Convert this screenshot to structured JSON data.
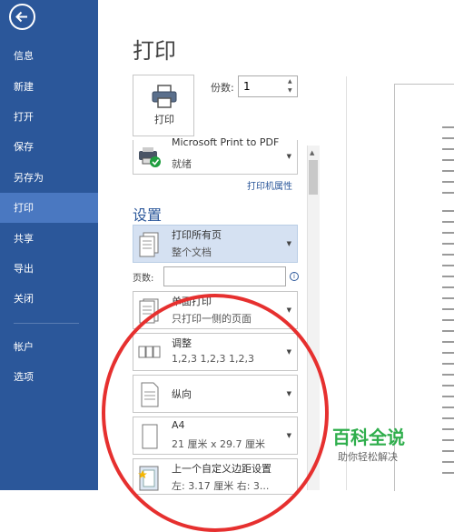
{
  "sidebar": {
    "items": [
      {
        "label": "信息"
      },
      {
        "label": "新建"
      },
      {
        "label": "打开"
      },
      {
        "label": "保存"
      },
      {
        "label": "另存为"
      },
      {
        "label": "打印"
      },
      {
        "label": "共享"
      },
      {
        "label": "导出"
      },
      {
        "label": "关闭"
      },
      {
        "label": "帐户"
      },
      {
        "label": "选项"
      }
    ]
  },
  "main": {
    "title": "打印",
    "print_button_label": "打印",
    "copies_label": "份数:",
    "copies_value": "1",
    "printer": {
      "name": "Microsoft Print to PDF",
      "status": "就绪",
      "properties_link": "打印机属性"
    },
    "settings_heading": "设置",
    "settings": [
      {
        "title": "打印所有页",
        "subtitle": "整个文档"
      },
      {
        "title": "单面打印",
        "subtitle": "只打印一侧的页面"
      },
      {
        "title": "调整",
        "subtitle": "1,2,3    1,2,3    1,2,3"
      },
      {
        "title": "纵向",
        "subtitle": ""
      },
      {
        "title": "A4",
        "subtitle": "21 厘米 x 29.7 厘米"
      },
      {
        "title": "上一个自定义边距设置",
        "subtitle": "左: 3.17 厘米    右: 3..."
      }
    ],
    "pages_label": "页数:",
    "pages_value": ""
  },
  "watermark": {
    "title": "百科全说",
    "subtitle": "助你轻松解决"
  },
  "colors": {
    "sidebar_bg": "#2b579a",
    "sidebar_active": "#4a78c1",
    "accent": "#2b579a",
    "highlight_circle": "#e6302f",
    "watermark_green": "#2fae4c"
  }
}
